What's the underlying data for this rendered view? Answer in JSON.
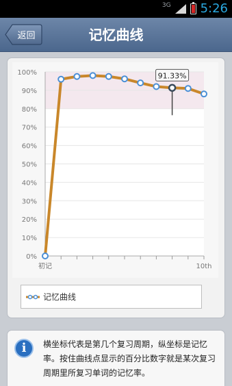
{
  "statusbar": {
    "network": "3G",
    "time": "5:26"
  },
  "header": {
    "back_label": "返回",
    "title": "记忆曲线"
  },
  "chart_data": {
    "type": "line",
    "x_labels": [
      "初记",
      "10th"
    ],
    "x": [
      0,
      1,
      2,
      3,
      4,
      5,
      6,
      7,
      8,
      9,
      10
    ],
    "series": [
      {
        "name": "记忆曲线",
        "values": [
          0,
          96,
          97.5,
          98,
          97.5,
          96.2,
          94,
          92,
          91.33,
          91,
          88
        ]
      }
    ],
    "yticks": [
      "0%",
      "10%",
      "20%",
      "30%",
      "40%",
      "50%",
      "60%",
      "70%",
      "80%",
      "90%",
      "100%"
    ],
    "ylim": [
      0,
      100
    ],
    "xlim": [
      0,
      10
    ],
    "tooltip": {
      "index": 8,
      "label": "91.33%"
    },
    "line_color": "#c9872a",
    "point_color": "#4a8fd6",
    "grid": true,
    "legend": "bottom"
  },
  "legend": {
    "label": "记忆曲线"
  },
  "info": {
    "text": "横坐标代表是第几个复习周期，纵坐标是记忆率。按住曲线点显示的百分比数字就是某次复习周期里所复习单词的记忆率。"
  }
}
